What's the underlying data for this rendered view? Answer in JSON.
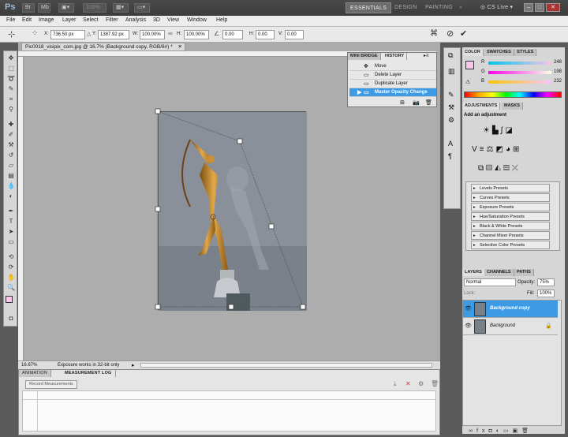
{
  "app": {
    "logo": "Ps",
    "menu": [
      "File",
      "Edit",
      "Image",
      "Layer",
      "Select",
      "Filter",
      "Analysis",
      "3D",
      "View",
      "Window",
      "Help"
    ],
    "zoom_select": "100%",
    "workspaces": [
      "ESSENTIALS",
      "DESIGN",
      "PAINTING"
    ],
    "cs_live": "CS Live"
  },
  "options": {
    "x_label": "X:",
    "x_value": "736.50 px",
    "y_label": "Y:",
    "y_value": "1387.92 px",
    "w_label": "W:",
    "w_value": "100.00%",
    "h_label": "H:",
    "h_value": "100.00%",
    "rotate_value": "0.00",
    "hskew_label": "H:",
    "hskew_value": "0.00",
    "vskew_label": "V:",
    "vskew_value": "0.00"
  },
  "document": {
    "tab_title": "Pic0018_visipix_com.jpg @ 16.7% (Background copy, RGB/8#) *",
    "zoom": "16.67%",
    "status": "Exposure works in 32-bit only"
  },
  "history": {
    "tabs": [
      "MINI BRIDGE",
      "HISTORY"
    ],
    "items": [
      "Move",
      "Delete Layer",
      "Duplicate Layer",
      "Master Opacity Change"
    ]
  },
  "color": {
    "tabs": [
      "COLOR",
      "SWATCHES",
      "STYLES"
    ],
    "r_label": "R",
    "r": "248",
    "g_label": "G",
    "g": "198",
    "b_label": "B",
    "b": "232",
    "fg_color": "#f8c6e8"
  },
  "adjustments": {
    "tabs": [
      "ADJUSTMENTS",
      "MASKS"
    ],
    "heading": "Add an adjustment",
    "presets": [
      "Levels Presets",
      "Curves Presets",
      "Exposure Presets",
      "Hue/Saturation Presets",
      "Black & White Presets",
      "Channel Mixer Presets",
      "Selective Color Presets"
    ]
  },
  "layers": {
    "tabs": [
      "LAYERS",
      "CHANNELS",
      "PATHS"
    ],
    "blend_mode": "Normal",
    "opacity_label": "Opacity:",
    "opacity": "75%",
    "lock_label": "Lock:",
    "fill_label": "Fill:",
    "fill": "100%",
    "items": [
      "Background copy",
      "Background"
    ]
  },
  "bottom": {
    "tabs": [
      "ANIMATION",
      "MEASUREMENT LOG"
    ],
    "record_button": "Record Measurements"
  },
  "colors": {
    "accent": "#3d9ae5",
    "canvas_bg": "#ababab"
  }
}
